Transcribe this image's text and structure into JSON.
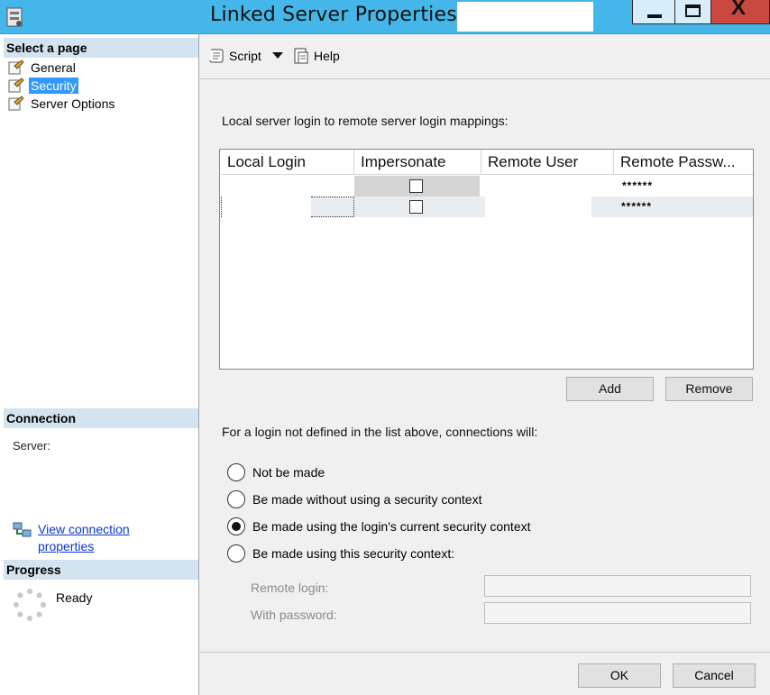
{
  "window": {
    "title": "Linked Server Properties -",
    "minimize_icon": "minimize-icon",
    "maximize_icon": "maximize-icon",
    "close_icon": "close-icon",
    "close_glyph": "X"
  },
  "left": {
    "select_page_header": "Select a page",
    "pages": [
      {
        "label": "General",
        "selected": false
      },
      {
        "label": "Security",
        "selected": true
      },
      {
        "label": "Server Options",
        "selected": false
      }
    ],
    "connection_header": "Connection",
    "server_label": "Server:",
    "view_connection_properties": "View connection properties",
    "progress_header": "Progress",
    "progress_status": "Ready"
  },
  "toolbar": {
    "script_label": "Script",
    "help_label": "Help"
  },
  "security": {
    "mappings_label": "Local server login to remote server login mappings:",
    "columns": [
      "Local Login",
      "Impersonate",
      "Remote User",
      "Remote Passw..."
    ],
    "rows": [
      {
        "local_login": "",
        "impersonate": false,
        "remote_user": "",
        "remote_password": "******"
      },
      {
        "local_login": "",
        "impersonate": false,
        "remote_user": "",
        "remote_password": "******"
      }
    ],
    "add_button": "Add",
    "remove_button": "Remove",
    "undefined_login_label": "For a login not defined in the list above, connections will:",
    "options": [
      {
        "label": "Not be made",
        "checked": false
      },
      {
        "label": "Be made without using a security context",
        "checked": false
      },
      {
        "label": "Be made using the login's current security context",
        "checked": true
      },
      {
        "label": "Be made using this security context:",
        "checked": false
      }
    ],
    "remote_login_label": "Remote login:",
    "remote_login_value": "",
    "with_password_label": "With password:",
    "with_password_value": ""
  },
  "dialog": {
    "ok_button": "OK",
    "cancel_button": "Cancel"
  },
  "colors": {
    "titlebar": "#45b6e9",
    "close_button": "#c9483f",
    "selection": "#3399ff",
    "section_header": "#d4e3ef",
    "link": "#0a37d6"
  }
}
